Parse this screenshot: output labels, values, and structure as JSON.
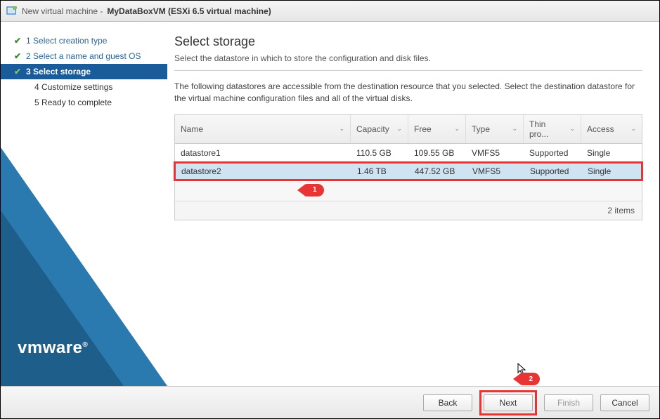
{
  "titlebar": {
    "prefix": "New virtual machine -",
    "main": "MyDataBoxVM (ESXi 6.5 virtual machine)"
  },
  "steps": [
    {
      "num": "1",
      "label": "Select creation type",
      "state": "done"
    },
    {
      "num": "2",
      "label": "Select a name and guest OS",
      "state": "done"
    },
    {
      "num": "3",
      "label": "Select storage",
      "state": "current"
    },
    {
      "num": "4",
      "label": "Customize settings",
      "state": "future"
    },
    {
      "num": "5",
      "label": "Ready to complete",
      "state": "future"
    }
  ],
  "logo": "vmware",
  "main": {
    "heading": "Select storage",
    "subtitle": "Select the datastore in which to store the configuration and disk files.",
    "description": "The following datastores are accessible from the destination resource that you selected. Select the destination datastore for the virtual machine configuration files and all of the virtual disks."
  },
  "table": {
    "columns": {
      "name": "Name",
      "capacity": "Capacity",
      "free": "Free",
      "type": "Type",
      "thin": "Thin pro...",
      "access": "Access"
    },
    "rows": [
      {
        "name": "datastore1",
        "capacity": "110.5 GB",
        "free": "109.55 GB",
        "type": "VMFS5",
        "thin": "Supported",
        "access": "Single",
        "selected": false
      },
      {
        "name": "datastore2",
        "capacity": "1.46 TB",
        "free": "447.52 GB",
        "type": "VMFS5",
        "thin": "Supported",
        "access": "Single",
        "selected": true
      }
    ],
    "footer": "2 items"
  },
  "callouts": {
    "one": "1",
    "two": "2"
  },
  "buttons": {
    "back": "Back",
    "next": "Next",
    "finish": "Finish",
    "cancel": "Cancel"
  }
}
